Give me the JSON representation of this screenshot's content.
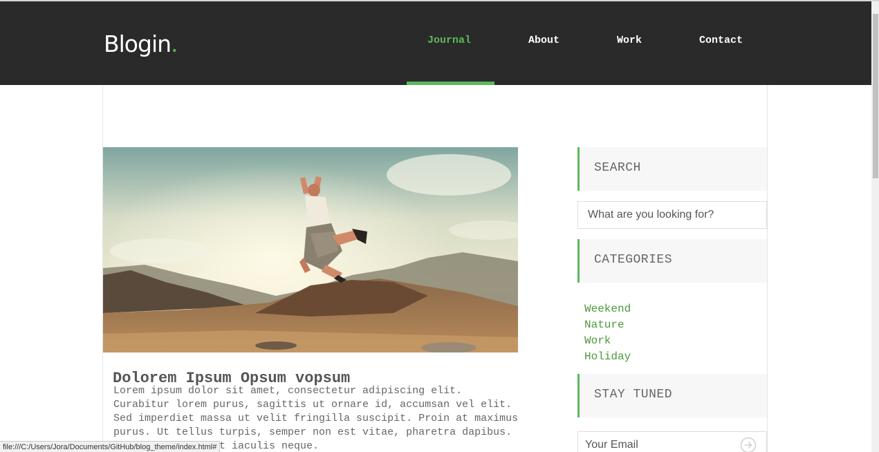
{
  "brand": {
    "name": "Blogin",
    "dot": "."
  },
  "nav": {
    "items": [
      {
        "label": "Journal",
        "active": true
      },
      {
        "label": "About",
        "active": false
      },
      {
        "label": "Work",
        "active": false
      },
      {
        "label": "Contact",
        "active": false
      }
    ]
  },
  "post": {
    "title": "Dolorem Ipsum Opsum vopsum",
    "body": "Lorem ipsum dolor sit amet, consectetur adipiscing elit. Curabitur lorem purus, sagittis ut ornare id, accumsan vel elit. Sed imperdiet massa ut velit fringilla suscipit. Proin at maximus purus. Ut tellus turpis, semper non est vitae, pharetra dapibus. Phasellus sit amet iaculis neque."
  },
  "sidebar": {
    "search": {
      "title": "SEARCH",
      "placeholder": "What are you looking for?"
    },
    "categories": {
      "title": "CATEGORIES",
      "items": [
        "Weekend",
        "Nature",
        "Work",
        "Holiday"
      ]
    },
    "stay_tuned": {
      "title": "STAY TUNED",
      "email_placeholder": "Your Email"
    }
  },
  "statusbar": {
    "url": "file:///C:/Users/Jora/Documents/GitHub/blog_theme/index.html#"
  },
  "colors": {
    "accent": "#5cb85c",
    "header_bg": "#2a2a2a",
    "link": "#4a9a3a"
  },
  "icons": {
    "email_submit": "arrow-circle-right-icon"
  }
}
